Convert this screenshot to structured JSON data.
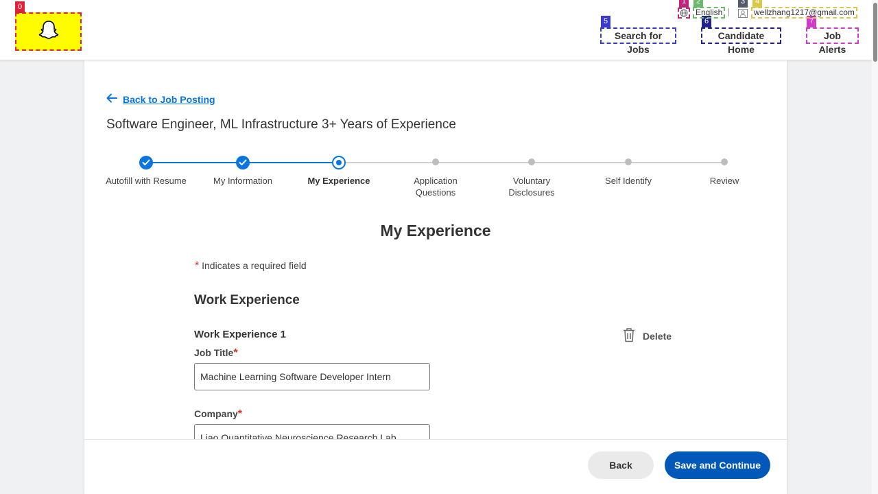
{
  "header": {
    "markers": [
      "0",
      "1",
      "2",
      "3",
      "4",
      "5",
      "6",
      "7"
    ],
    "language": "English",
    "account_email": "wellzhang1217@gmail.com",
    "nav": {
      "search_jobs": "Search for Jobs",
      "candidate_home": "Candidate Home",
      "job_alerts": "Job Alerts"
    },
    "logo_icon": "snapchat-ghost-icon",
    "logo_color": "#fffc00"
  },
  "page": {
    "back_link": "Back to Job Posting",
    "job_title": "Software Engineer, ML Infrastructure 3+ Years of Experience"
  },
  "stepper": {
    "steps": [
      {
        "label": "Autofill with Resume",
        "status": "complete"
      },
      {
        "label": "My Information",
        "status": "complete"
      },
      {
        "label": "My Experience",
        "status": "current"
      },
      {
        "label": "Application Questions",
        "status": "upcoming"
      },
      {
        "label": "Voluntary Disclosures",
        "status": "upcoming"
      },
      {
        "label": "Self Identify",
        "status": "upcoming"
      },
      {
        "label": "Review",
        "status": "upcoming"
      }
    ]
  },
  "form": {
    "section_title": "My Experience",
    "required_marker": "*",
    "required_note": "Indicates a required field",
    "work_experience_heading": "Work Experience",
    "entry_heading": "Work Experience 1",
    "delete_label": "Delete",
    "job_title_label": "Job Title",
    "job_title_value": "Machine Learning Software Developer Intern",
    "company_label": "Company",
    "company_value": "Liao Quantitative Neuroscience Research Lab"
  },
  "footer": {
    "back_label": "Back",
    "save_label": "Save and Continue"
  },
  "colors": {
    "accent": "#0875e1",
    "primary_button": "#0058b8",
    "required": "#de2e21"
  }
}
